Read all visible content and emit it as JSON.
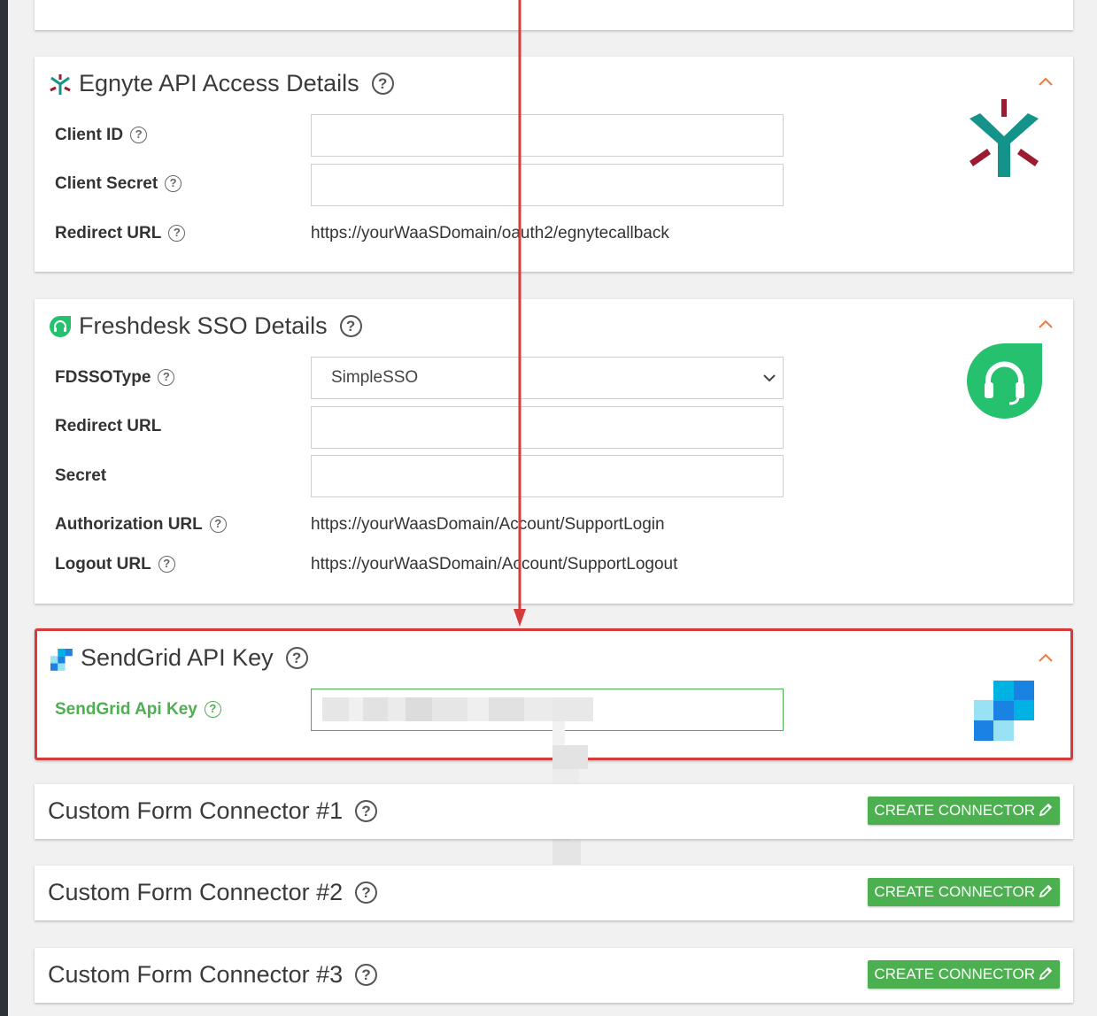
{
  "egnyte": {
    "title": "Egnyte API Access Details",
    "icon": "egnyte-logo-icon",
    "fields": [
      {
        "label": "Client ID",
        "value": ""
      },
      {
        "label": "Client Secret",
        "value": ""
      },
      {
        "label": "Redirect URL",
        "value": "https://yourWaaSDomain/oauth2/egnytecallback"
      }
    ]
  },
  "freshdesk": {
    "title": "Freshdesk SSO Details",
    "icon": "freshdesk-headset-icon",
    "fields": [
      {
        "label": "FDSSOType",
        "value": "SimpleSSO"
      },
      {
        "label": "Redirect URL",
        "value": ""
      },
      {
        "label": "Secret",
        "value": ""
      },
      {
        "label": "Authorization URL",
        "value": "https://yourWaasDomain/Account/SupportLogin"
      },
      {
        "label": "Logout URL",
        "value": "https://yourWaaSDomain/Account/SupportLogout"
      }
    ]
  },
  "sendgrid": {
    "title": "SendGrid API Key",
    "icon": "sendgrid-logo-icon",
    "fields": [
      {
        "label": "SendGrid Api Key",
        "value": ""
      }
    ]
  },
  "connectors": [
    {
      "title": "Custom Form Connector #1",
      "button": "CREATE CONNECTOR"
    },
    {
      "title": "Custom Form Connector #2",
      "button": "CREATE CONNECTOR"
    },
    {
      "title": "Custom Form Connector #3",
      "button": "CREATE CONNECTOR"
    }
  ],
  "help_glyph": "?",
  "colors": {
    "accent_green": "#4caf50",
    "highlight_red": "#d63a3a",
    "chevron_orange": "#f07a3c",
    "egnyte_teal": "#13938a",
    "egnyte_red": "#9b1b30",
    "freshdesk_green": "#25c16f",
    "sendgrid_blue": "#1a82e2"
  }
}
